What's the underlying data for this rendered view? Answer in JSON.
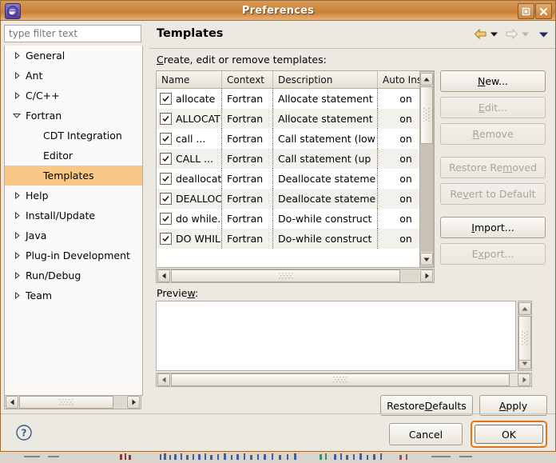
{
  "window": {
    "title": "Preferences",
    "icon": "eclipse-icon",
    "maximize_label": "maximize",
    "close_label": "close"
  },
  "sidebar": {
    "filter": {
      "placeholder": "type filter text",
      "value": ""
    },
    "items": [
      {
        "label": "General",
        "state": "collapsed",
        "level": 0,
        "selected": false
      },
      {
        "label": "Ant",
        "state": "collapsed",
        "level": 0,
        "selected": false
      },
      {
        "label": "C/C++",
        "state": "collapsed",
        "level": 0,
        "selected": false
      },
      {
        "label": "Fortran",
        "state": "expanded",
        "level": 0,
        "selected": false
      },
      {
        "label": "CDT Integration",
        "state": "leaf",
        "level": 1,
        "selected": false
      },
      {
        "label": "Editor",
        "state": "leaf",
        "level": 1,
        "selected": false
      },
      {
        "label": "Templates",
        "state": "leaf",
        "level": 1,
        "selected": true
      },
      {
        "label": "Help",
        "state": "collapsed",
        "level": 0,
        "selected": false
      },
      {
        "label": "Install/Update",
        "state": "collapsed",
        "level": 0,
        "selected": false
      },
      {
        "label": "Java",
        "state": "collapsed",
        "level": 0,
        "selected": false
      },
      {
        "label": "Plug-in Development",
        "state": "collapsed",
        "level": 0,
        "selected": false
      },
      {
        "label": "Run/Debug",
        "state": "collapsed",
        "level": 0,
        "selected": false
      },
      {
        "label": "Team",
        "state": "collapsed",
        "level": 0,
        "selected": false
      }
    ]
  },
  "page": {
    "title": "Templates",
    "description_label": "Create, edit or remove templates:",
    "description_mnemonic": "C",
    "nav": {
      "back_icon": "back-arrow-icon",
      "back_menu_icon": "dropdown-arrow-icon",
      "forward_icon": "forward-arrow-icon",
      "forward_menu_icon": "dropdown-arrow-icon",
      "view_menu_icon": "dropdown-arrow-icon"
    }
  },
  "table": {
    "columns": [
      "Name",
      "Context",
      "Description",
      "Auto Inse"
    ],
    "rows": [
      {
        "checked": true,
        "name": "allocate",
        "context": "Fortran",
        "description": "Allocate statement",
        "auto_insert": "on"
      },
      {
        "checked": true,
        "name": "ALLOCAT",
        "context": "Fortran",
        "description": "Allocate statement",
        "auto_insert": "on"
      },
      {
        "checked": true,
        "name": "call ...",
        "context": "Fortran",
        "description": "Call statement (low",
        "auto_insert": "on"
      },
      {
        "checked": true,
        "name": "CALL ...",
        "context": "Fortran",
        "description": "Call statement (up",
        "auto_insert": "on"
      },
      {
        "checked": true,
        "name": "deallocat",
        "context": "Fortran",
        "description": "Deallocate stateme",
        "auto_insert": "on"
      },
      {
        "checked": true,
        "name": "DEALLOC",
        "context": "Fortran",
        "description": "Deallocate stateme",
        "auto_insert": "on"
      },
      {
        "checked": true,
        "name": "do while.",
        "context": "Fortran",
        "description": "Do-while construct",
        "auto_insert": "on"
      },
      {
        "checked": true,
        "name": "DO WHIL",
        "context": "Fortran",
        "description": "Do-while construct",
        "auto_insert": "on"
      }
    ]
  },
  "side_buttons": [
    {
      "label": "New...",
      "mnemonic": "N",
      "enabled": true
    },
    {
      "label": "Edit...",
      "mnemonic": "E",
      "enabled": false
    },
    {
      "label": "Remove",
      "mnemonic": "R",
      "enabled": false
    },
    {
      "label": "Restore Removed",
      "mnemonic": "m",
      "enabled": false
    },
    {
      "label": "Revert to Default",
      "mnemonic": "v",
      "enabled": false
    },
    {
      "label": "Import...",
      "mnemonic": "I",
      "enabled": true
    },
    {
      "label": "Export...",
      "mnemonic": "x",
      "enabled": false
    }
  ],
  "preview": {
    "label": "Preview:",
    "mnemonic": "w",
    "value": ""
  },
  "page_buttons": {
    "restore_defaults": "Restore Defaults",
    "restore_defaults_mnemonic": "D",
    "apply": "Apply",
    "apply_mnemonic": "A"
  },
  "footer": {
    "help_icon": "help-question-icon",
    "cancel": "Cancel",
    "ok": "OK"
  },
  "colors": {
    "titlebar": "#cf8a43",
    "selection": "#f9c887",
    "focus_ring": "#e2761c",
    "panel": "#ece9e2"
  }
}
